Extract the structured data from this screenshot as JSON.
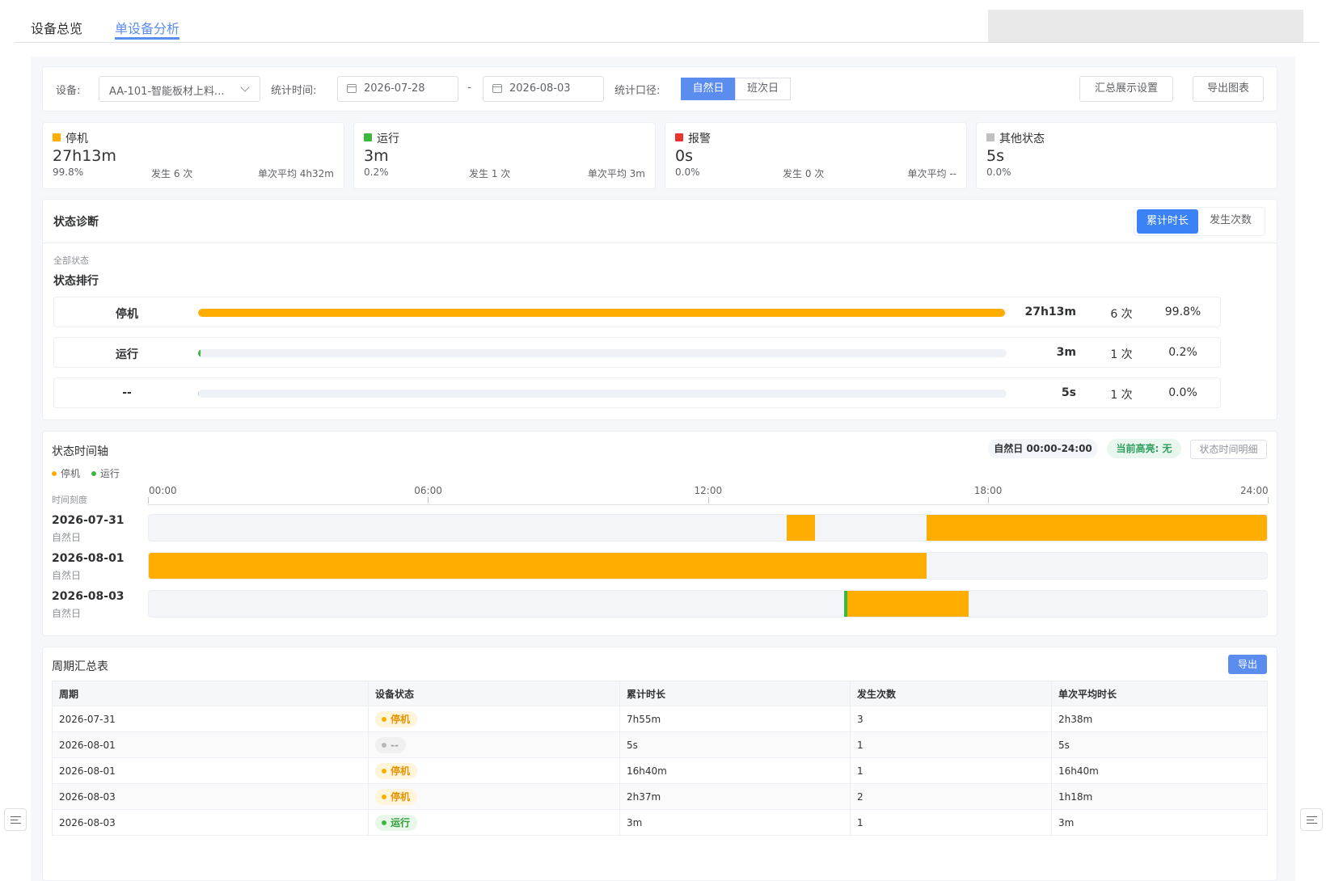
{
  "tabs": [
    {
      "label": "设备总览",
      "active": false
    },
    {
      "label": "单设备分析",
      "active": true
    }
  ],
  "filters": {
    "device_label": "设备:",
    "device_value": "AA-101-智能板材上料...",
    "time_label": "统计时间:",
    "start_date": "2026-07-28",
    "range_sep": "-",
    "end_date": "2026-08-03",
    "basis_label": "统计口径:",
    "basis_options": [
      "自然日",
      "班次日"
    ],
    "basis_selected": "自然日",
    "summary_settings_button": "汇总展示设置",
    "export_chart_button": "导出图表"
  },
  "summary_cards": [
    {
      "name": "停机",
      "color": "#ffad00",
      "total": "27h13m",
      "percent": "99.8%",
      "occurrences": "发生 6 次",
      "average": "单次平均 4h32m"
    },
    {
      "name": "运行",
      "color": "#3db73d",
      "total": "3m",
      "percent": "0.2%",
      "occurrences": "发生 1 次",
      "average": "单次平均 3m"
    },
    {
      "name": "报警",
      "color": "#e8332f",
      "total": "0s",
      "percent": "0.0%",
      "occurrences": "发生 0 次",
      "average": "单次平均 --"
    },
    {
      "name": "其他状态",
      "color": "#c0c0c0",
      "total": "5s",
      "percent": "0.0%",
      "occurrences": "",
      "average": ""
    }
  ],
  "diagnosis": {
    "title": "状态诊断",
    "toggle": [
      "累计时长",
      "发生次数"
    ],
    "toggle_selected": "累计时长",
    "scope_label": "全部状态",
    "ranking_title": "状态排行",
    "ranking": [
      {
        "name": "停机",
        "duration": "27h13m",
        "count": "6 次",
        "percent": "99.8%",
        "share": 0.998,
        "color": "#ffad00"
      },
      {
        "name": "运行",
        "duration": "3m",
        "count": "1 次",
        "percent": "0.2%",
        "share": 0.002,
        "color": "#3db73d"
      },
      {
        "name": "--",
        "duration": "5s",
        "count": "1 次",
        "percent": "0.0%",
        "share": 0.0,
        "color": "#c0c4cc"
      }
    ]
  },
  "timeline": {
    "title": "状态时间轴",
    "legend": [
      {
        "name": "停机",
        "color": "#ffad00"
      },
      {
        "name": "运行",
        "color": "#3db73d"
      }
    ],
    "range_pill": "自然日 00:00-24:00",
    "highlight_pill": "当前高亮: 无",
    "detail_button": "状态时间明细",
    "axis_label": "时间刻度",
    "ticks": [
      "00:00",
      "06:00",
      "12:00",
      "18:00",
      "24:00"
    ],
    "day_sub": "自然日",
    "days": [
      {
        "date": "2026-07-31",
        "segments": [
          {
            "status": "停机",
            "start_h": 13.7,
            "end_h": 14.3
          },
          {
            "status": "停机",
            "start_h": 16.7,
            "end_h": 24.0
          }
        ]
      },
      {
        "date": "2026-08-01",
        "segments": [
          {
            "status": "停机",
            "start_h": 0.0,
            "end_h": 16.7
          }
        ]
      },
      {
        "date": "2026-08-03",
        "segments": [
          {
            "status": "运行",
            "start_h": 14.93,
            "end_h": 15.0
          },
          {
            "status": "停机",
            "start_h": 15.0,
            "end_h": 17.6
          }
        ]
      }
    ]
  },
  "period_table": {
    "title": "周期汇总表",
    "export_button": "导出",
    "columns": [
      "周期",
      "设备状态",
      "累计时长",
      "发生次数",
      "单次平均时长"
    ],
    "rows": [
      {
        "period": "2026-07-31",
        "status": "停机",
        "status_kind": "stop",
        "total": "7h55m",
        "count": "3",
        "avg": "2h38m"
      },
      {
        "period": "2026-08-01",
        "status": "--",
        "status_kind": "other",
        "total": "5s",
        "count": "1",
        "avg": "5s"
      },
      {
        "period": "2026-08-01",
        "status": "停机",
        "status_kind": "stop",
        "total": "16h40m",
        "count": "1",
        "avg": "16h40m"
      },
      {
        "period": "2026-08-03",
        "status": "停机",
        "status_kind": "stop",
        "total": "2h37m",
        "count": "2",
        "avg": "1h18m"
      },
      {
        "period": "2026-08-03",
        "status": "运行",
        "status_kind": "run",
        "total": "3m",
        "count": "1",
        "avg": "3m"
      }
    ]
  },
  "colors": {
    "accent": "#5b8def",
    "stop": "#ffad00",
    "run": "#3db73d",
    "alarm": "#e8332f",
    "other": "#c0c0c0"
  }
}
